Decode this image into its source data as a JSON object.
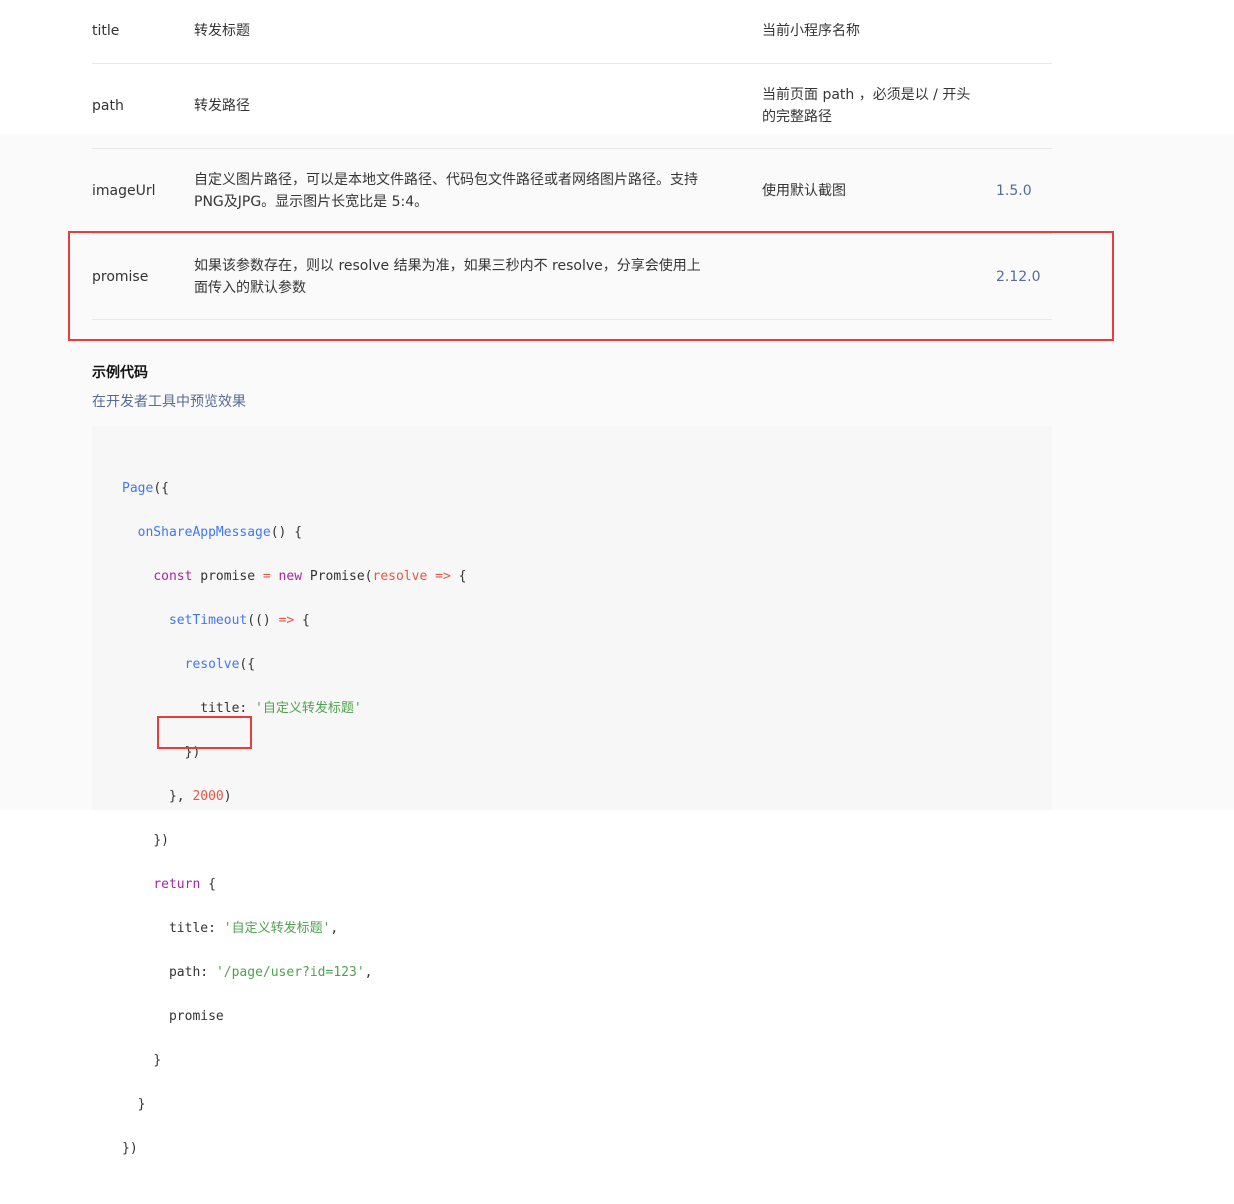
{
  "table": {
    "rows": [
      {
        "name": "title",
        "desc": "转发标题",
        "default": "当前小程序名称",
        "version": ""
      },
      {
        "name": "path",
        "desc": "转发路径",
        "default": "当前页面 path ，必须是以 / 开头的完整路径",
        "version": ""
      },
      {
        "name": "imageUrl",
        "desc": "自定义图片路径，可以是本地文件路径、代码包文件路径或者网络图片路径。支持PNG及JPG。显示图片长宽比是 5:4。",
        "default": "使用默认截图",
        "version": "1.5.0"
      },
      {
        "name": "promise",
        "desc": "如果该参数存在，则以 resolve 结果为准，如果三秒内不 resolve，分享会使用上面传入的默认参数",
        "default": "",
        "version": "2.12.0"
      }
    ]
  },
  "example": {
    "title": "示例代码",
    "preview_link": "在开发者工具中预览效果"
  },
  "code": {
    "l1_page": "Page",
    "l1_rest": "({",
    "l2_fn": "onShareAppMessage",
    "l2_rest": "() {",
    "l3_const": "const",
    "l3_var": " promise ",
    "l3_eq": "=",
    "l3_new": " new",
    "l3_promise": " Promise(",
    "l3_param": "resolve",
    "l3_arrow": " =>",
    "l3_rest": " {",
    "l4_fn": "setTimeout",
    "l4_open": "(() ",
    "l4_arrow": "=>",
    "l4_rest": " {",
    "l5_fn": "resolve",
    "l5_rest": "({",
    "l6_key": "title: ",
    "l6_str": "'自定义转发标题'",
    "l7": "})",
    "l8_open": "}, ",
    "l8_num": "2000",
    "l8_close": ")",
    "l9": "})",
    "l10_kw": "return",
    "l10_rest": " {",
    "l11_key": "title: ",
    "l11_str": "'自定义转发标题'",
    "l11_comma": ",",
    "l12_key": "path: ",
    "l12_str": "'/page/user?id=123'",
    "l12_comma": ",",
    "l13": "promise",
    "l14": "}",
    "l15": "}",
    "l16": "})"
  },
  "colors": {
    "highlight": "#e53e3e",
    "link": "#576b95",
    "keyword": "#a626a4",
    "function": "#4078f2",
    "string": "#50a14f",
    "number": "#e45649"
  }
}
